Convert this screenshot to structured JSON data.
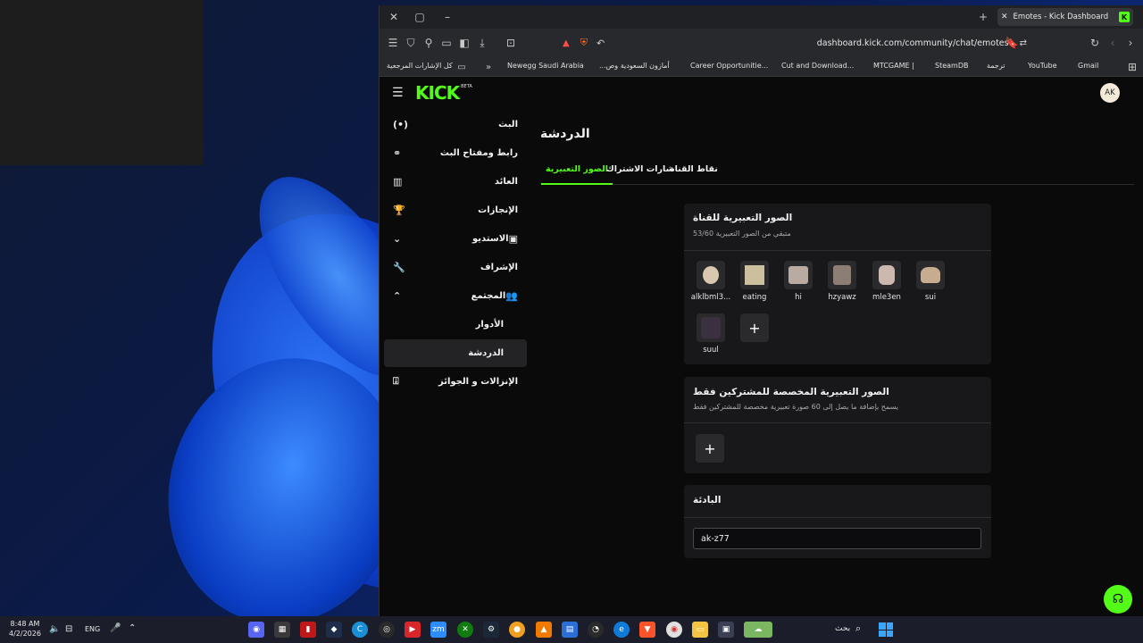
{
  "browser": {
    "tab_title": "Emotes - Kick Dashboard",
    "url": "dashboard.kick.com/community/chat/emotes",
    "bookmarks": [
      "كل الإشارات المرجعية",
      "Newegg Saudi Arabia",
      "أمازون السعودية وص...",
      "Career Opportunitie...",
      "Cut and Download...",
      "MTCGAME |",
      "SteamDB",
      "ترجمة",
      "YouTube",
      "Gmail"
    ]
  },
  "header": {
    "logo_text": "KICK",
    "beta_label": "BETA",
    "avatar_text": "AK"
  },
  "sidebar": {
    "items": [
      {
        "label": "البث",
        "icon": "broadcast-icon"
      },
      {
        "label": "رابط ومفتاح البث",
        "icon": "link-icon"
      },
      {
        "label": "العائد",
        "icon": "chart-icon"
      },
      {
        "label": "الإنجازات",
        "icon": "trophy-icon"
      },
      {
        "label": "الاستديو",
        "icon": "studio-icon"
      },
      {
        "label": "الإشراف",
        "icon": "wrench-icon"
      },
      {
        "label": "المجتمع",
        "icon": "community-icon"
      },
      {
        "label": "الأدوار"
      },
      {
        "label": "الدردشة"
      },
      {
        "label": "الإنزالات و الجوائز",
        "icon": "gift-icon"
      }
    ]
  },
  "main": {
    "title": "الدردشة",
    "tabs": [
      "الصور التعبيرية",
      "شارات الاشتراك",
      "نقاط القناة"
    ],
    "channel_emotes": {
      "title": "الصور التعبيرية للقناة",
      "subtitle": "متبقي من الصور التعبيرية 53/60",
      "emotes": [
        "alklbml3...",
        "eating",
        "hi",
        "hzyawz",
        "mle3en",
        "sui",
        "suul"
      ]
    },
    "sub_emotes": {
      "title": "الصور التعبيرية المخصصة للمشتركين فقط",
      "subtitle": "يسمح بإضافة ما يصل إلى 60 صورة تعبيرية مخصصة للمشتركين فقط"
    },
    "prefix": {
      "title": "البادئة",
      "value": "ak-z77"
    }
  },
  "taskbar": {
    "time": "8:48 AM",
    "date": "4/2/2026",
    "language": "ENG",
    "search_label": "بحث"
  },
  "colors": {
    "accent": "#53fc18",
    "page_bg": "#0a0a0b",
    "card_bg": "#18181a"
  }
}
